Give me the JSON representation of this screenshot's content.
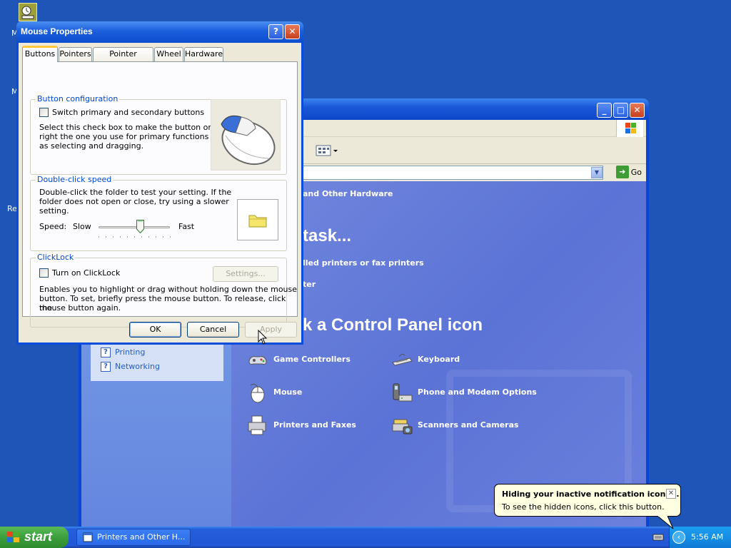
{
  "desktop": {
    "icons": [
      {
        "name": "scheduled-task-icon"
      },
      {
        "label": "M"
      },
      {
        "label": "M"
      },
      {
        "label": "Re"
      }
    ]
  },
  "control_panel": {
    "header": "and Other Hardware",
    "task_heading": "task...",
    "tasks": [
      "lled printers or fax printers",
      "ter"
    ],
    "icon_heading": "k a Control Panel icon",
    "address_go_label": "Go",
    "see_also": [
      "Printing",
      "Networking"
    ],
    "icons": [
      {
        "label": "Game Controllers",
        "icon": "game-controller-icon"
      },
      {
        "label": "Keyboard",
        "icon": "keyboard-icon"
      },
      {
        "label": "Mouse",
        "icon": "mouse-icon"
      },
      {
        "label": "Phone and Modem Options",
        "icon": "phone-modem-icon"
      },
      {
        "label": "Printers and Faxes",
        "icon": "printer-icon"
      },
      {
        "label": "Scanners and Cameras",
        "icon": "scanner-icon"
      }
    ]
  },
  "dialog": {
    "title": "Mouse Properties",
    "tabs": [
      "Buttons",
      "Pointers",
      "Pointer Options",
      "Wheel",
      "Hardware"
    ],
    "button_config": {
      "legend": "Button configuration",
      "checkbox_label": "Switch primary and secondary buttons",
      "checked": false,
      "description_lines": [
        "Select this check box to make the button on the",
        "right the one you use for primary functions such",
        "as selecting and dragging."
      ]
    },
    "double_click": {
      "legend": "Double-click speed",
      "description_lines": [
        "Double-click the folder to test your setting. If the",
        "folder does not open or close, try using a slower",
        "setting."
      ],
      "speed_label": "Speed:",
      "slow_label": "Slow",
      "fast_label": "Fast",
      "speed_value": 0.58
    },
    "clicklock": {
      "legend": "ClickLock",
      "checkbox_label": "Turn on ClickLock",
      "checked": false,
      "settings_button": "Settings...",
      "description_lines": [
        "Enables you to highlight or drag without holding down the mouse",
        "button. To set, briefly press the mouse button. To release, click the",
        "mouse button again."
      ]
    },
    "buttons": {
      "ok": "OK",
      "cancel": "Cancel",
      "apply": "Apply"
    }
  },
  "taskbar": {
    "start_label": "start",
    "task_button": "Printers and Other H...",
    "clock": "5:56 AM"
  },
  "balloon": {
    "title": "Hiding your inactive notification icons...",
    "text": "To see the hidden icons, click this button."
  },
  "colors": {
    "desktop": "#1f55b6",
    "title_bar": "#0a46d4",
    "start_button": "#3c9e3c",
    "dialog_face": "#ece9d8",
    "tab_highlight": "#ffc73c"
  }
}
